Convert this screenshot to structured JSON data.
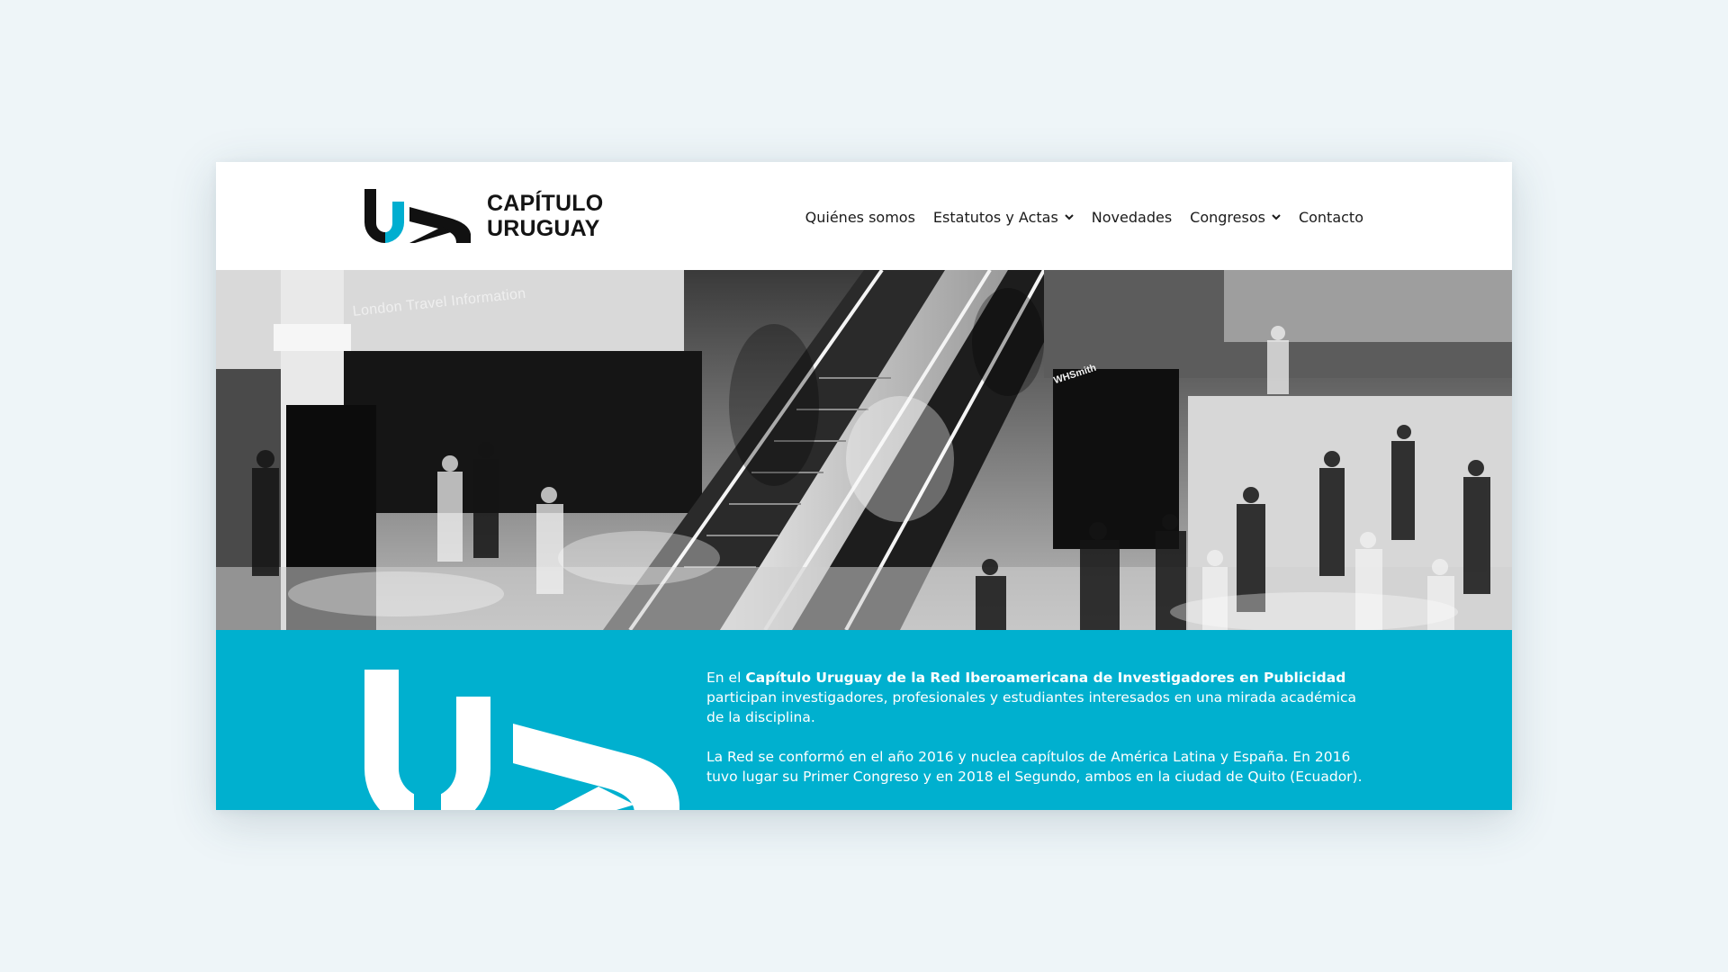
{
  "logo": {
    "line1": "CAPÍTULO",
    "line2": "URUGUAY",
    "colors": {
      "dark": "#111111",
      "accent": "#00aed0"
    }
  },
  "nav": {
    "items": [
      {
        "label": "Quiénes somos",
        "has_dropdown": false
      },
      {
        "label": "Estatutos y Actas",
        "has_dropdown": true,
        "icon": "chevron-down-icon"
      },
      {
        "label": "Novedades",
        "has_dropdown": false
      },
      {
        "label": "Congresos",
        "has_dropdown": true,
        "icon": "chevron-down-icon"
      },
      {
        "label": "Contacto",
        "has_dropdown": false
      }
    ]
  },
  "hero": {
    "sign_text": "London Travel Information",
    "shop_sign": "WHSmith"
  },
  "intro": {
    "p1_before": "En el ",
    "p1_bold": "Capítulo Uruguay de la Red Iberoamericana de Investigadores en Publicidad",
    "p1_after": " participan investigadores, profesionales y estudiantes interesados en una mirada académica de la disciplina.",
    "p2": "La Red se conformó en el año 2016 y nuclea capítulos de América Latina y España. En 2016 tuvo lugar su Primer Congreso y en 2018 el Segundo, ambos en la ciudad de Quito (Ecuador).",
    "colors": {
      "band": "#00b0cf",
      "text": "#ffffff"
    }
  }
}
